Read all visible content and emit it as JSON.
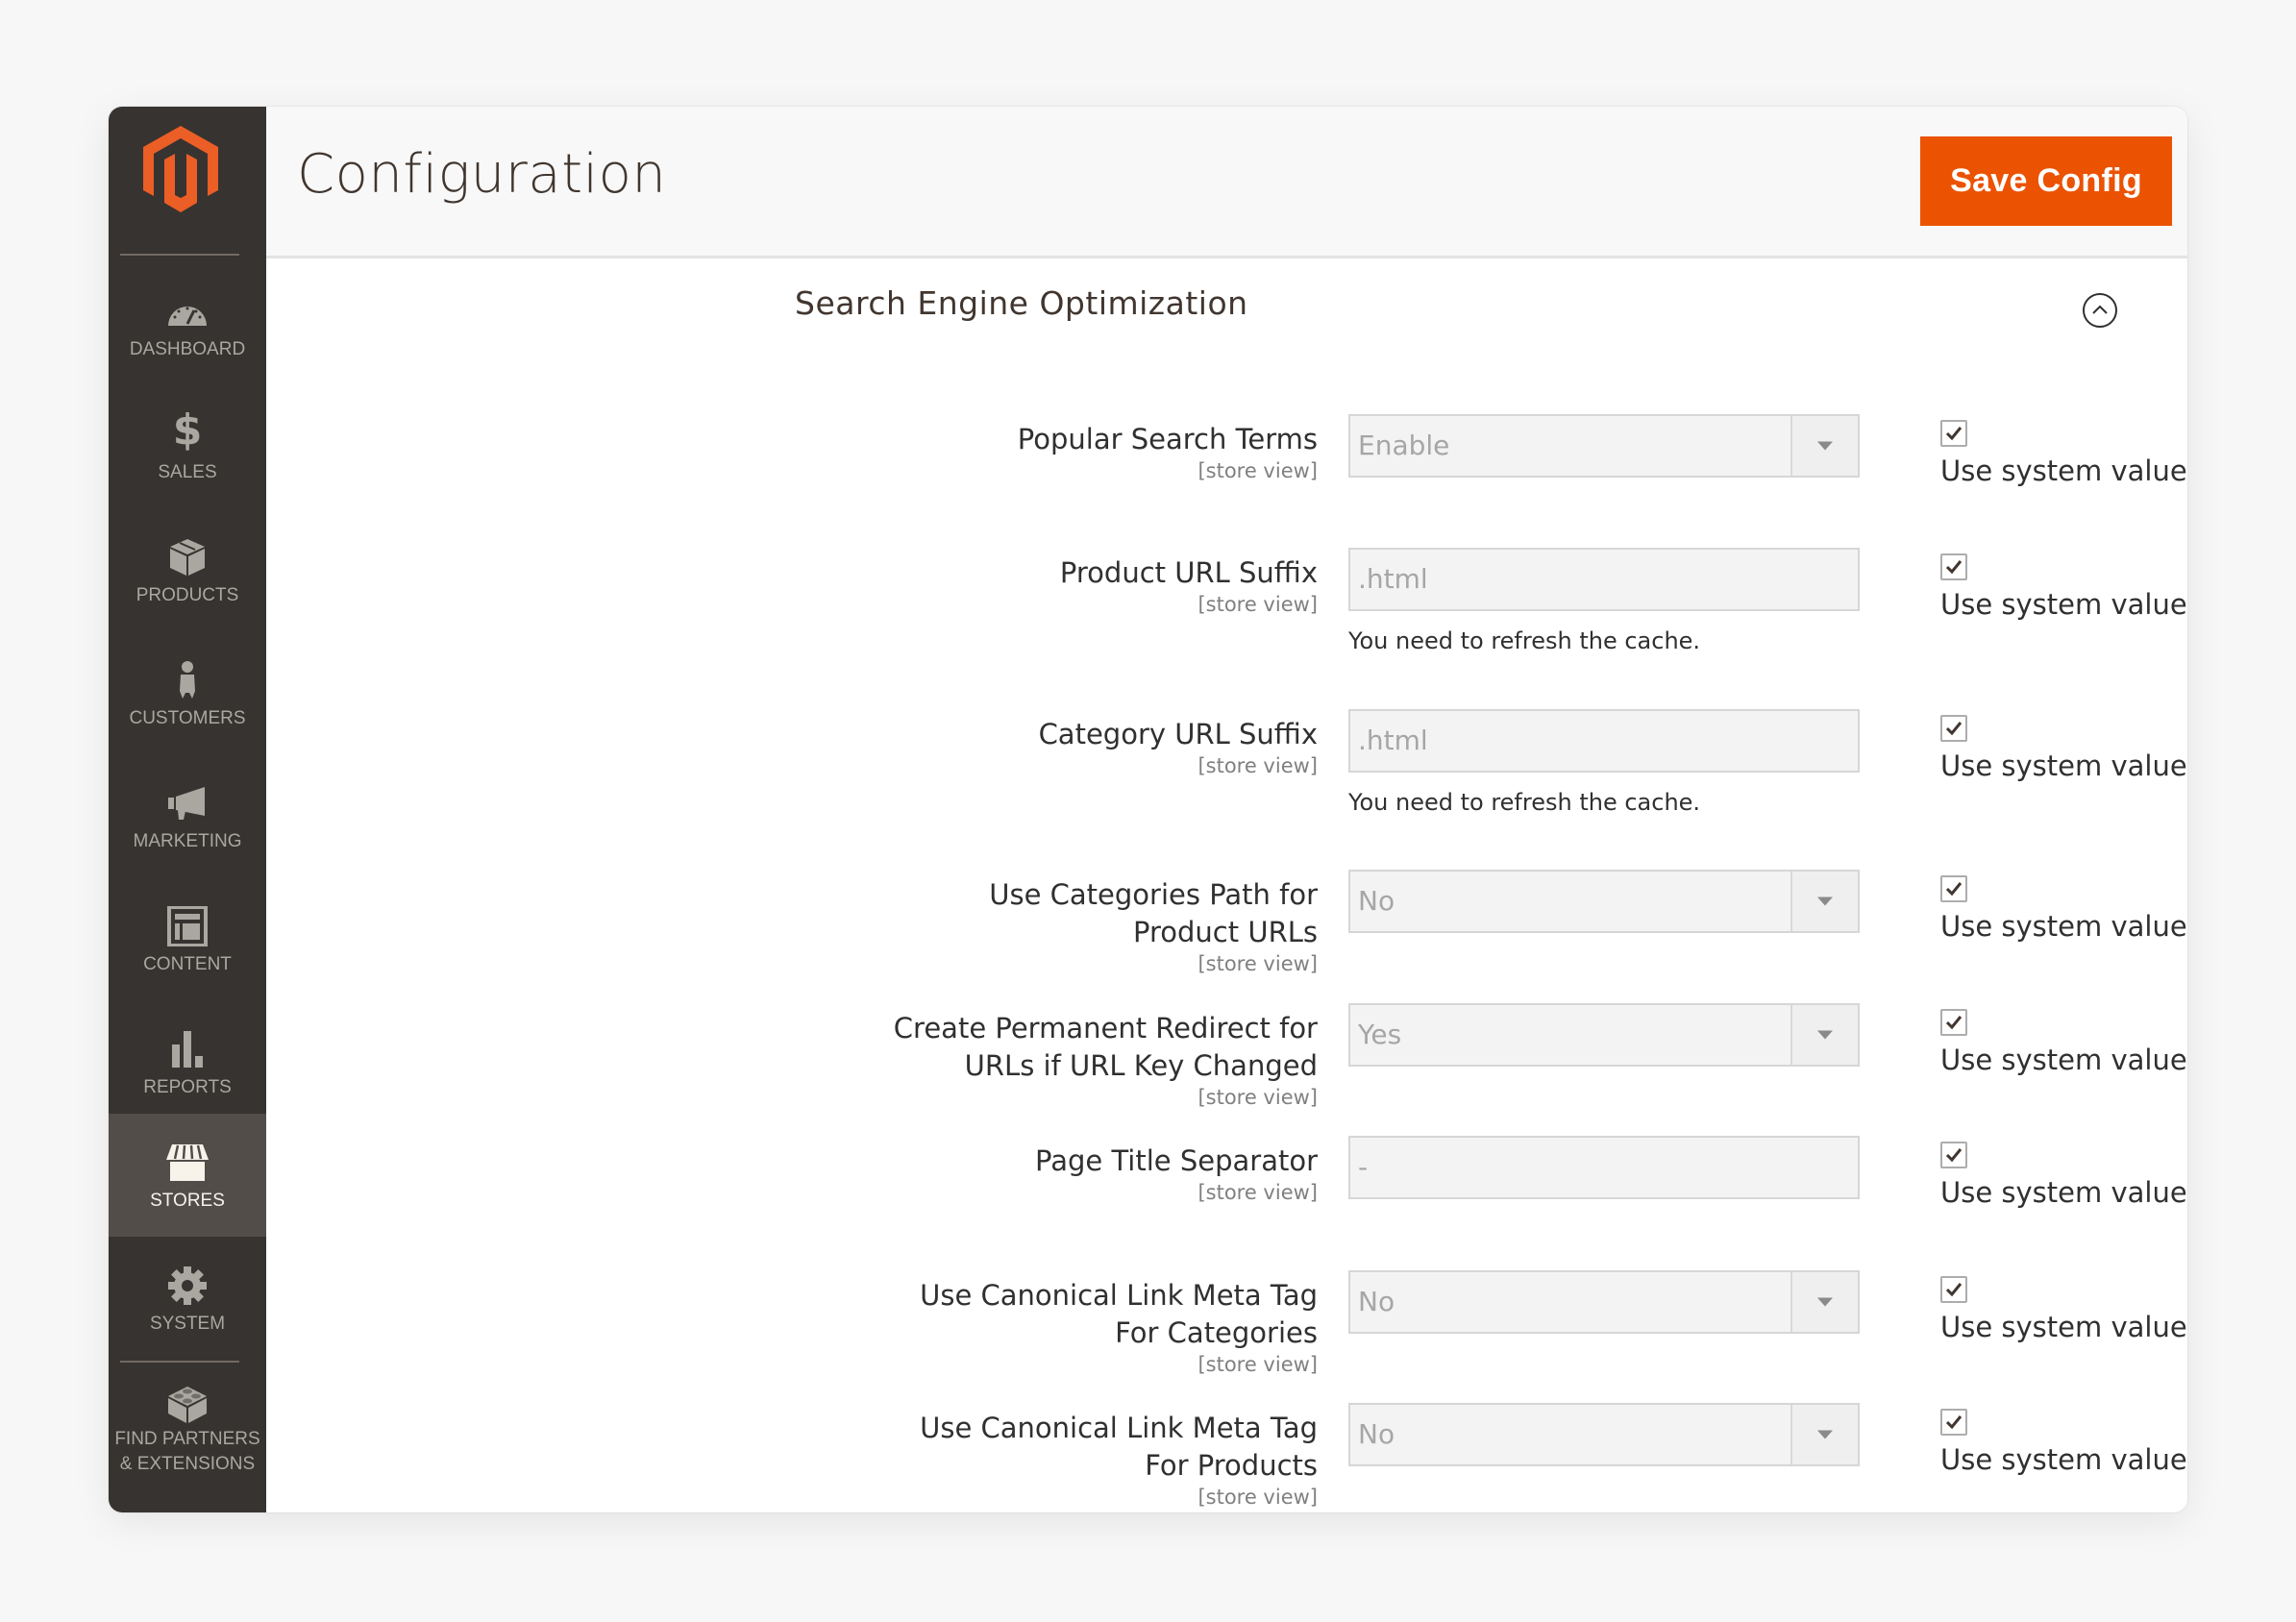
{
  "app": {
    "name": "Magento Admin",
    "brand_color": "#eb5202",
    "sidebar_color": "#373330"
  },
  "sidebar": {
    "items": [
      {
        "label": "DASHBOARD",
        "icon": "dashboard-gauge-icon",
        "active": false
      },
      {
        "label": "SALES",
        "icon": "dollar-icon",
        "active": false
      },
      {
        "label": "PRODUCTS",
        "icon": "box-icon",
        "active": false
      },
      {
        "label": "CUSTOMERS",
        "icon": "person-icon",
        "active": false
      },
      {
        "label": "MARKETING",
        "icon": "megaphone-icon",
        "active": false
      },
      {
        "label": "CONTENT",
        "icon": "layout-icon",
        "active": false
      },
      {
        "label": "REPORTS",
        "icon": "bar-chart-icon",
        "active": false
      },
      {
        "label": "STORES",
        "icon": "storefront-icon",
        "active": true
      },
      {
        "label": "SYSTEM",
        "icon": "gear-icon",
        "active": false
      },
      {
        "label_line1": "FIND PARTNERS",
        "label_line2": "& EXTENSIONS",
        "icon": "lego-block-icon",
        "active": false
      }
    ]
  },
  "header": {
    "title": "Configuration",
    "save_label": "Save Config"
  },
  "section": {
    "title": "Search Engine Optimization",
    "expanded": true
  },
  "fields": [
    {
      "label_lines": [
        "Popular Search Terms"
      ],
      "scope": "[store view]",
      "type": "select",
      "value": "Enable",
      "note": "",
      "use_system_value": true,
      "system_label": "Use system value"
    },
    {
      "label_lines": [
        "Product URL Suffix"
      ],
      "scope": "[store view]",
      "type": "text",
      "value": ".html",
      "note": "You need to refresh the cache.",
      "use_system_value": true,
      "system_label": "Use system value"
    },
    {
      "label_lines": [
        "Category URL Suffix"
      ],
      "scope": "[store view]",
      "type": "text",
      "value": ".html",
      "note": "You need to refresh the cache.",
      "use_system_value": true,
      "system_label": "Use system value"
    },
    {
      "label_lines": [
        "Use Categories Path for",
        "Product URLs"
      ],
      "scope": "[store view]",
      "type": "select",
      "value": "No",
      "note": "",
      "use_system_value": true,
      "system_label": "Use system value"
    },
    {
      "label_lines": [
        "Create Permanent Redirect for",
        "URLs if URL Key Changed"
      ],
      "scope": "[store view]",
      "type": "select",
      "value": "Yes",
      "note": "",
      "use_system_value": true,
      "system_label": "Use system value"
    },
    {
      "label_lines": [
        "Page Title Separator"
      ],
      "scope": "[store view]",
      "type": "text",
      "value": "-",
      "note": "",
      "use_system_value": true,
      "system_label": "Use system value"
    },
    {
      "label_lines": [
        "Use Canonical Link Meta Tag",
        "For Categories"
      ],
      "scope": "[store view]",
      "type": "select",
      "value": "No",
      "note": "",
      "use_system_value": true,
      "system_label": "Use system value"
    },
    {
      "label_lines": [
        "Use Canonical Link Meta Tag",
        "For Products"
      ],
      "scope": "[store view]",
      "type": "select",
      "value": "No",
      "note": "",
      "use_system_value": true,
      "system_label": "Use system value"
    }
  ]
}
